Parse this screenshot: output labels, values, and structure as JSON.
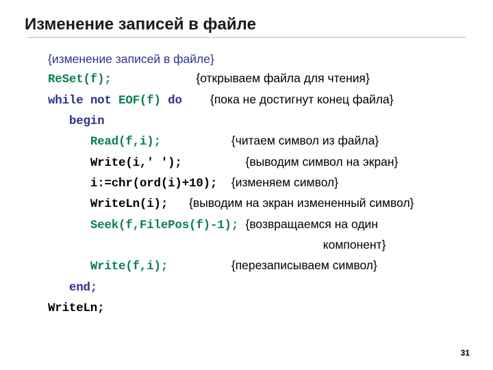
{
  "title": "Изменение записей в файле",
  "pagenum": "31",
  "lines": {
    "l1_cmt": "{изменение записей в файле}",
    "l2_code": "ReSet(f);",
    "l2_cmt": "{открываем файла для чтения}",
    "l3_while": "while ",
    "l3_not": "not ",
    "l3_eof": "EOF(f)",
    "l3_do": " do",
    "l3_cmt": "{пока не достигнут конец файла}",
    "l4_begin": "begin",
    "l5_code": "Read(f,i);",
    "l5_cmt": "{читаем символ из файла}",
    "l6_code": "Write(i,' ');",
    "l6_cmt": "{выводим символ на экран}",
    "l7_code": "i:=chr(ord(i)+10);",
    "l7_cmt": "{изменяем символ}",
    "l8_code": "WriteLn(i);",
    "l8_cmt": "{выводим на экран измененный символ}",
    "l9_code": "Seek(f,FilePos(f)-1);",
    "l9_cmt": "{возвращаемся на один",
    "l10_cmt": "компонент}",
    "l11_code": "Write(f,i);",
    "l11_cmt": "{перезаписываем символ}",
    "l12_end": "end;",
    "l13_writeln": "WriteLn;"
  }
}
